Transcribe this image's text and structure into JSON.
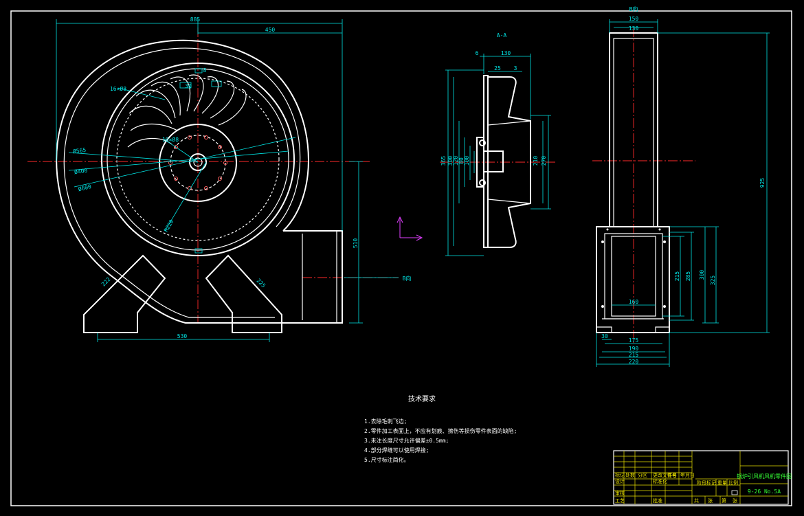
{
  "drawing": {
    "view_labels": {
      "section_aa": "A-A",
      "view_b": "B向",
      "view_b_arrow": "B向"
    },
    "dimensions": {
      "front": {
        "width_885": "885",
        "width_450": "450",
        "blades": "16×Ø8",
        "hub_8": "8",
        "bolt_circle": "10×Ø8",
        "d_565": "Ø565",
        "d_400": "Ø400",
        "d_600": "Ø600",
        "r_220": "R220",
        "h_510": "510",
        "leg_left": "222",
        "leg_right": "225",
        "base_530": "530",
        "small_30": "30"
      },
      "section": {
        "d_6": "6",
        "d_130": "130",
        "d_25": "25",
        "d_3": "3",
        "v_365": "365",
        "v_300": "300",
        "v_120": "120",
        "v_80": "80",
        "v_100": "100",
        "v_210": "210",
        "v_270": "270"
      },
      "side": {
        "w_150": "150",
        "w_130": "130",
        "h_925": "925",
        "h_215": "215",
        "h_285": "285",
        "h_300": "300",
        "h_325": "325",
        "w_160": "160",
        "w_175": "175",
        "w_190": "190",
        "w_215": "215",
        "w_220": "220",
        "small_30": "30"
      }
    },
    "technical_requirements": {
      "title": "技术要求",
      "items": [
        "1.去除毛刺飞边;",
        "2.零件加工表面上，不应有划痕、擦伤等损伤零件表面的缺陷;",
        "3.未注长度尺寸允许偏差±0.5mm;",
        "4.部分焊缝可以使用焊接;",
        "5.尺寸标注简化。"
      ]
    },
    "title_block": {
      "drawing_name": "锅炉引风机风机零件图",
      "drawing_code": "9-26 No.5A",
      "cells": [
        "标记",
        "处数",
        "分区",
        "更改文件号",
        "签名",
        "年月日",
        "设计",
        "标准化",
        "阶段标记",
        "重量",
        "比例",
        "审核",
        "工艺",
        "批准",
        "共",
        "张",
        "第",
        "张"
      ]
    },
    "colors": {
      "outline": "#ffffff",
      "dimension": "#00e5e5",
      "center_line": "#ff2a2a",
      "ucs_icon": "#e040ff",
      "title_text": "#34ff34",
      "border": "#e8e000"
    }
  }
}
